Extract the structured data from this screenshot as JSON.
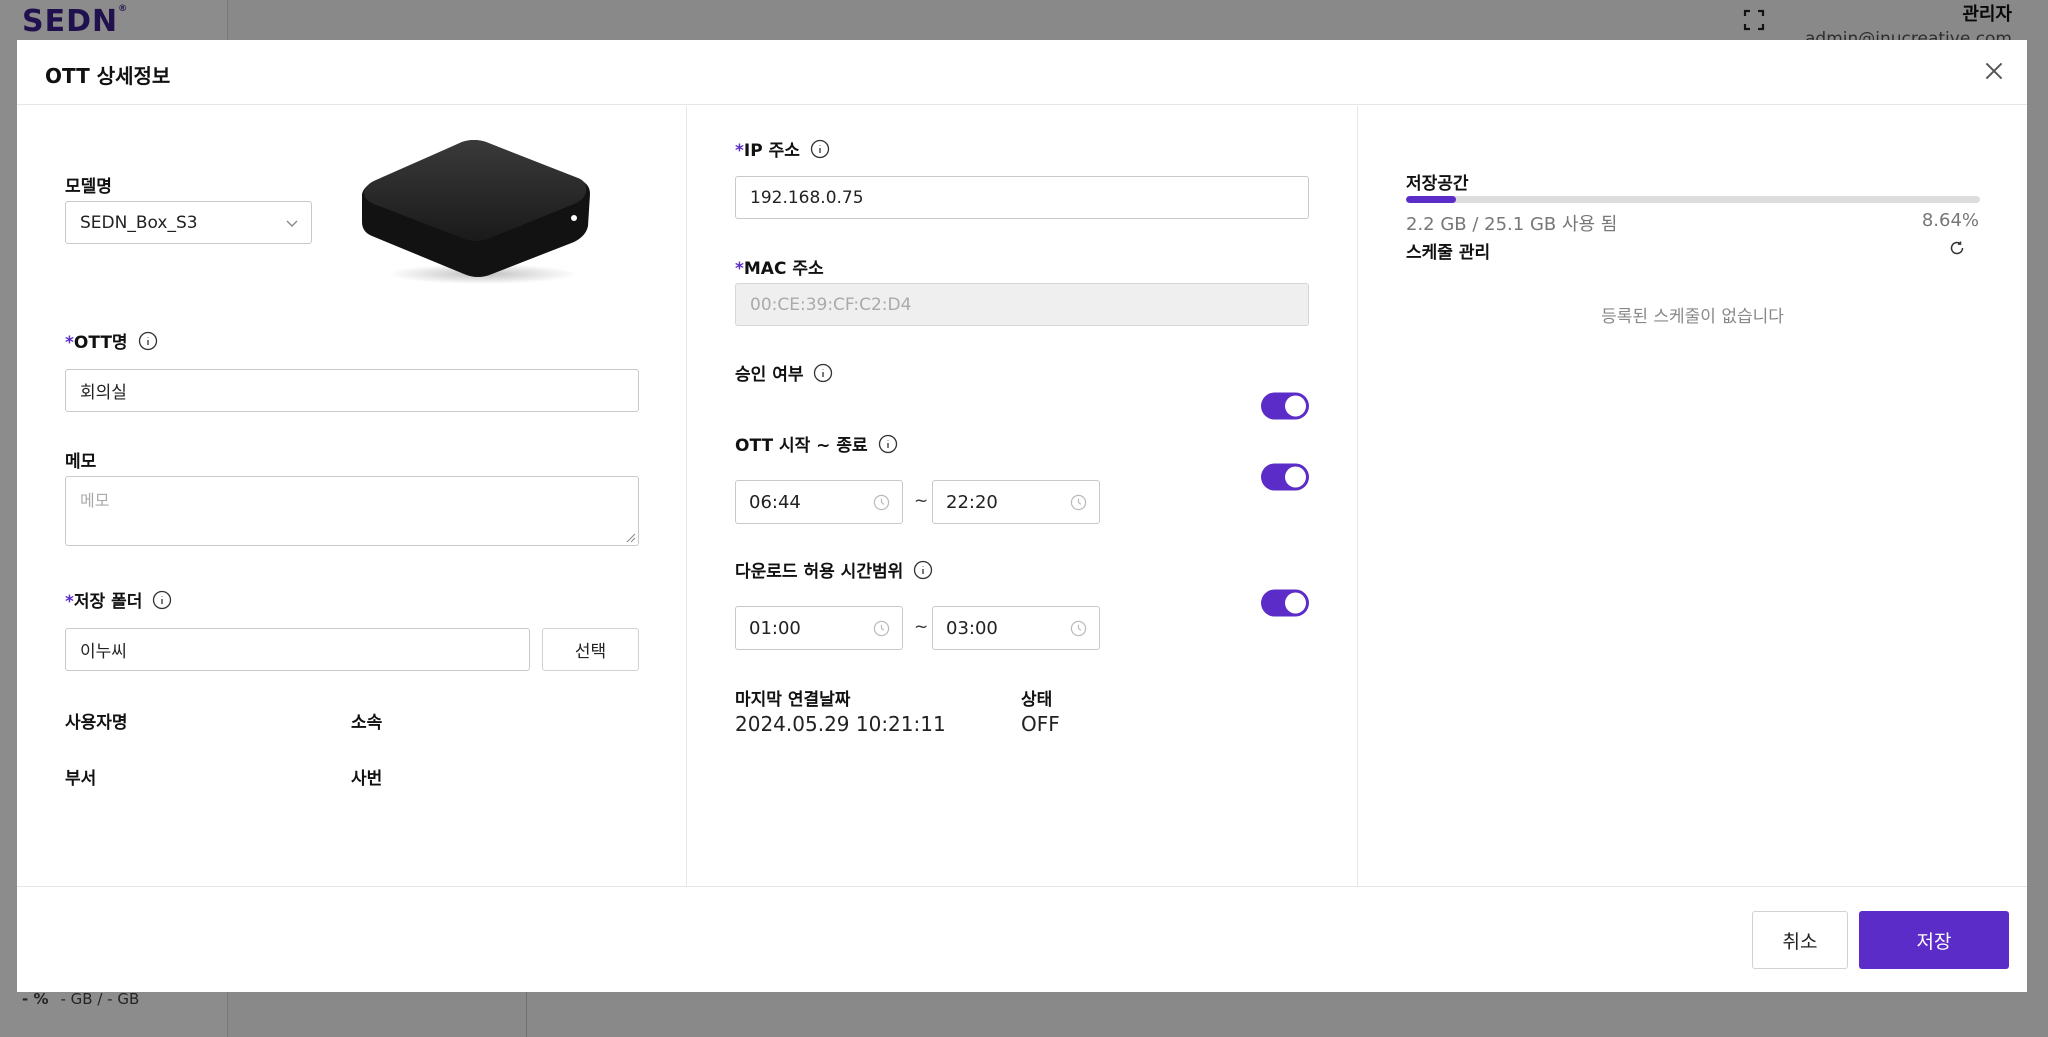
{
  "app": {
    "logo": "SEDN",
    "logo_mark": "®",
    "user_name": "관리자",
    "user_email": "admin@inucreative.com",
    "footer_percent": "- %",
    "footer_storage": "- GB / - GB"
  },
  "modal": {
    "title": "OTT 상세정보",
    "required_mark": "*"
  },
  "left": {
    "model_label": "모델명",
    "model_value": "SEDN_Box_S3",
    "ott_name_label": "OTT명",
    "ott_name_value": "회의실",
    "memo_label": "메모",
    "memo_placeholder": "메모",
    "folder_label": "저장 폴더",
    "folder_value": "이누씨",
    "select_button": "선택",
    "user_name_label": "사용자명",
    "affiliation_label": "소속",
    "department_label": "부서",
    "employee_id_label": "사번"
  },
  "middle": {
    "ip_label": "IP 주소",
    "ip_value": "192.168.0.75",
    "mac_label": "MAC 주소",
    "mac_value": "00:CE:39:CF:C2:D4",
    "approval_label": "승인 여부",
    "approval_on": true,
    "ott_time_label": "OTT 시작 ~ 종료",
    "ott_time_on": true,
    "ott_start": "06:44",
    "ott_end": "22:20",
    "download_label": "다운로드 허용 시간범위",
    "download_on": true,
    "download_start": "01:00",
    "download_end": "03:00",
    "tilde": "~",
    "last_connected_label": "마지막 연결날짜",
    "last_connected_value": "2024.05.29 10:21:11",
    "status_label": "상태",
    "status_value": "OFF"
  },
  "right": {
    "storage_label": "저장공간",
    "storage_used_text": "2.2 GB / 25.1 GB 사용 됨",
    "storage_percent_text": "8.64%",
    "storage_fraction": 0.0864,
    "schedule_label": "스케줄 관리",
    "schedule_empty": "등록된 스케줄이 없습니다"
  },
  "footer": {
    "cancel": "취소",
    "save": "저장"
  },
  "colors": {
    "accent": "#5b2cc7"
  }
}
